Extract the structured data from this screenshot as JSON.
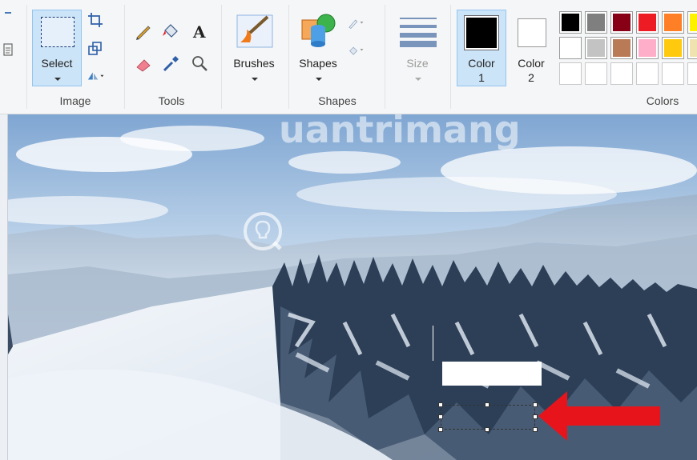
{
  "ribbon": {
    "groups": {
      "image": "Image",
      "tools": "Tools",
      "shapes": "Shapes",
      "colors": "Colors"
    },
    "select_label": "Select",
    "brushes_label": "Brushes",
    "shapes_label": "Shapes",
    "size_label": "Size",
    "color1_label": "Color 1",
    "color2_label": "Color 2",
    "color1_line1": "Color",
    "color1_line2": "1",
    "color2_line1": "Color",
    "color2_line2": "2",
    "color1_value": "#000000",
    "color2_value": "#ffffff",
    "palette_row1": [
      "#000000",
      "#7f7f7f",
      "#880015",
      "#ed1c24",
      "#ff7f27",
      "#fff200"
    ],
    "palette_row2": [
      "#ffffff",
      "#c3c3c3",
      "#b97a57",
      "#ffaec9",
      "#ffc90e",
      "#efe4b0"
    ],
    "palette_row3": [
      "",
      "",
      "",
      "",
      "",
      ""
    ]
  },
  "canvas": {
    "watermark": "uantrimang"
  },
  "colors": {
    "accent": "#cce4f7",
    "arrow": "#e8141b"
  }
}
